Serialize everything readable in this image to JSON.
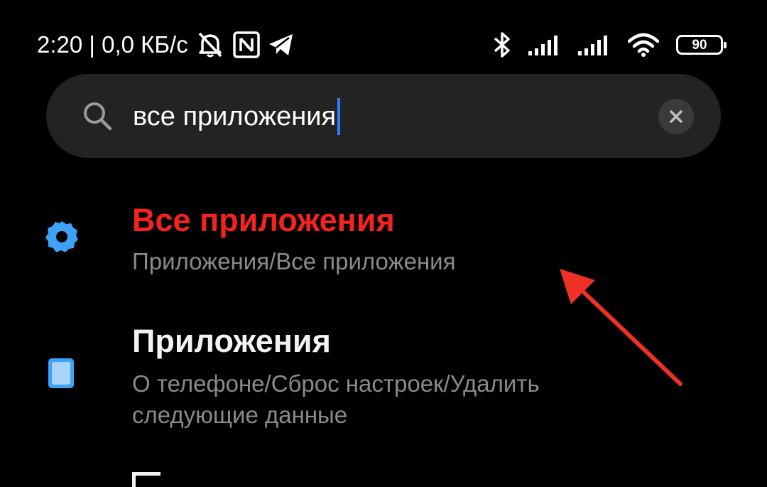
{
  "status_bar": {
    "info_text": "2:20 | 0,0 КБ/с",
    "icons": [
      "muted-bell-icon",
      "nfc-icon",
      "telegram-icon",
      "bluetooth-icon",
      "signal-icon",
      "signal-icon",
      "wifi-icon"
    ],
    "battery_level": "90"
  },
  "search": {
    "query": "все приложения",
    "caret_color": "#2f7dff",
    "icon": "search-icon",
    "clear_icon": "close-icon"
  },
  "results": [
    {
      "title": "Все приложения",
      "path": "Приложения/Все приложения",
      "icon": "gear-icon",
      "title_color": "#f5231c"
    },
    {
      "title": "Приложения",
      "path": "О телефоне/Сброс настроек/Удалить следующие данные",
      "icon": "phone-icon",
      "title_color": "#f2f2f2"
    }
  ],
  "annotation": {
    "arrow_color": "#ee3124",
    "icon": "red-arrow-icon"
  },
  "colors": {
    "background": "#000000",
    "search_bar": "#232323",
    "accent_blue": "#3ea2f7",
    "path_text": "#8a8a8a"
  }
}
